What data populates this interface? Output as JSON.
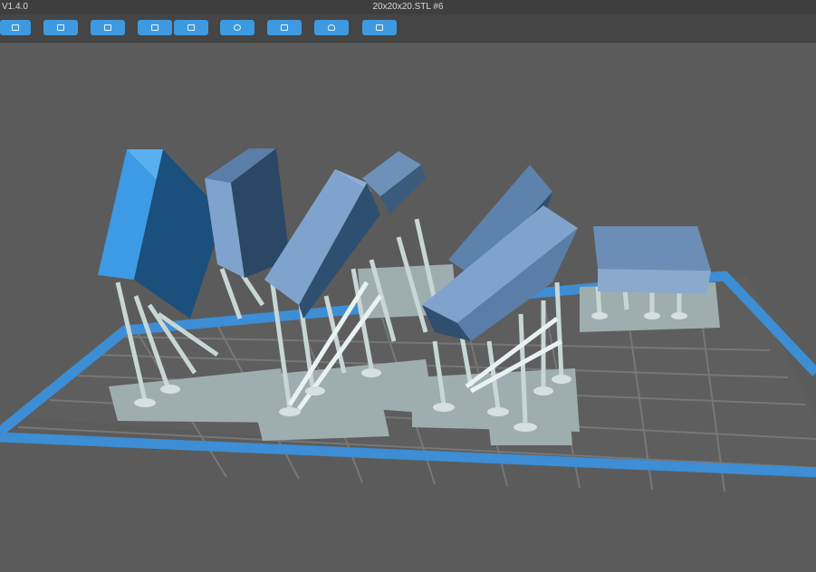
{
  "app": {
    "version": "V1.4.0"
  },
  "window": {
    "title": "20x20x20.STL #6"
  },
  "toolbar": {
    "buttons": [
      {
        "name": "open-file-button",
        "icon": "open-file-icon"
      },
      {
        "name": "save-file-button",
        "icon": "save-icon"
      },
      {
        "name": "select-all-button",
        "icon": "select-all-icon"
      },
      {
        "name": "import-button",
        "icon": "import-icon"
      },
      {
        "name": "export-button",
        "icon": "export-icon"
      },
      {
        "name": "settings-button",
        "icon": "gear-icon"
      },
      {
        "name": "auto-layout-button",
        "icon": "layout-icon"
      },
      {
        "name": "support-button",
        "icon": "support-icon"
      },
      {
        "name": "slice-button",
        "icon": "slice-icon"
      }
    ]
  },
  "viewport": {
    "scene": "build-plate-with-supported-models",
    "colors": {
      "background": "#5b5b5b",
      "plate_border": "#3d8ed4",
      "grid": "#777777",
      "support": "#bfcfcf",
      "model_selected": "#3d9ae4",
      "model": "#7fa3cd"
    }
  }
}
